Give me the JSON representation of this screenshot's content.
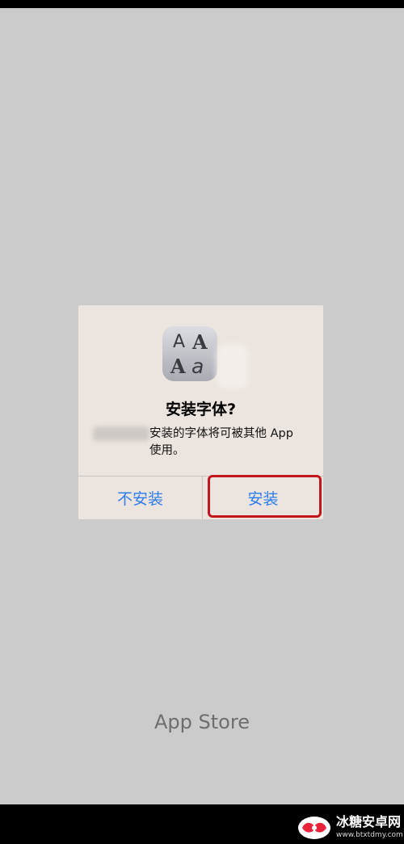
{
  "dialog": {
    "title": "安装字体?",
    "message": "安装的字体将可被其他 App\n使用。",
    "cancel_label": "不安装",
    "install_label": "安装",
    "icon": "font-icon",
    "icon_glyphs": [
      "A",
      "A",
      "A",
      "a"
    ]
  },
  "footer": {
    "label": "App Store"
  },
  "watermark": {
    "name": "冰糖安卓网",
    "url": "www.btxtdmy.com"
  },
  "colors": {
    "background": "#cbcbcb",
    "dialog_bg": "#ece5df",
    "button_text": "#2d7cf0",
    "highlight": "#c2161c",
    "footer_text": "#6e6e6e"
  }
}
